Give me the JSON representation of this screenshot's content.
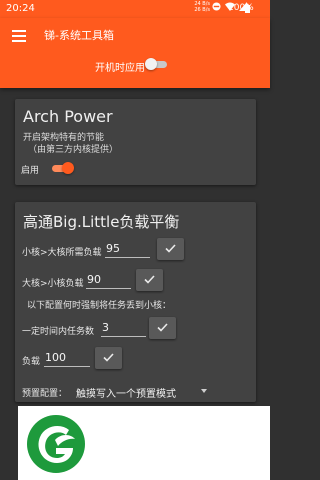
{
  "status_bar": {
    "time": "20:24",
    "network_speed_top": "24 B/s",
    "network_speed_bottom": "26 B/s",
    "icons": [
      "dnd-icon",
      "wifi-icon",
      "signal-icon",
      "battery-icon"
    ],
    "battery": "100%"
  },
  "app_bar": {
    "title": "锑-系统工具箱",
    "apply_on_boot_label": "开机时应用",
    "apply_on_boot": false,
    "background_color": "#ff5a1e"
  },
  "arch_power": {
    "title": "Arch Power",
    "description": "开启架构特有的节能",
    "sub_description": "（由第三方内核提供）",
    "enable_label": "启用",
    "enabled": true
  },
  "big_little": {
    "title": "高通Big.Little负载平衡",
    "little_to_big_label": "小核>大核所需负载",
    "little_to_big_value": "95",
    "big_to_little_label": "大核>小核负载",
    "big_to_little_value": "90",
    "force_note": "以下配置何时强制将任务丢到小核：",
    "task_count_label": "一定时间内任务数",
    "task_count_value": "3",
    "load_label": "负载",
    "load_value": "100",
    "preset_label": "预置配置：",
    "preset_value": "触摸写入一个预置模式"
  }
}
